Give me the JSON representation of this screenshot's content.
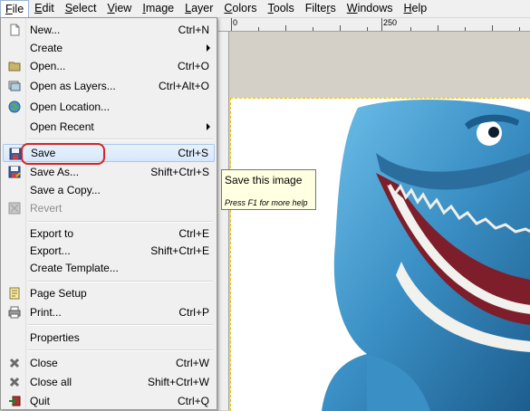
{
  "menubar": [
    {
      "label": "File",
      "u": "F"
    },
    {
      "label": "Edit",
      "u": "E"
    },
    {
      "label": "Select",
      "u": "S"
    },
    {
      "label": "View",
      "u": "V"
    },
    {
      "label": "Image",
      "u": "I"
    },
    {
      "label": "Layer",
      "u": "L"
    },
    {
      "label": "Colors",
      "u": "C"
    },
    {
      "label": "Tools",
      "u": "T"
    },
    {
      "label": "Filters",
      "u": "r"
    },
    {
      "label": "Windows",
      "u": "W"
    },
    {
      "label": "Help",
      "u": "H"
    }
  ],
  "ruler": {
    "label_0": "0",
    "label_250": "250"
  },
  "file_menu": {
    "new": {
      "label": "New...",
      "shortcut": "Ctrl+N"
    },
    "create": {
      "label": "Create"
    },
    "open": {
      "label": "Open...",
      "shortcut": "Ctrl+O"
    },
    "open_as_layers": {
      "label": "Open as Layers...",
      "shortcut": "Ctrl+Alt+O"
    },
    "open_location": {
      "label": "Open Location..."
    },
    "open_recent": {
      "label": "Open Recent"
    },
    "save": {
      "label": "Save",
      "shortcut": "Ctrl+S"
    },
    "save_as": {
      "label": "Save As...",
      "shortcut": "Shift+Ctrl+S"
    },
    "save_copy": {
      "label": "Save a Copy..."
    },
    "revert": {
      "label": "Revert"
    },
    "export_to": {
      "label": "Export to",
      "shortcut": "Ctrl+E"
    },
    "export": {
      "label": "Export...",
      "shortcut": "Shift+Ctrl+E"
    },
    "create_template": {
      "label": "Create Template..."
    },
    "page_setup": {
      "label": "Page Setup"
    },
    "print": {
      "label": "Print...",
      "shortcut": "Ctrl+P"
    },
    "properties": {
      "label": "Properties"
    },
    "close": {
      "label": "Close",
      "shortcut": "Ctrl+W"
    },
    "close_all": {
      "label": "Close all",
      "shortcut": "Shift+Ctrl+W"
    },
    "quit": {
      "label": "Quit",
      "shortcut": "Ctrl+Q"
    }
  },
  "tooltip": {
    "title": "Save this image",
    "hint": "Press F1 for more help"
  },
  "colors": {
    "highlight": "#d9231f",
    "tooltip_bg": "#ffffe1",
    "shark": "#3a8fc4"
  }
}
